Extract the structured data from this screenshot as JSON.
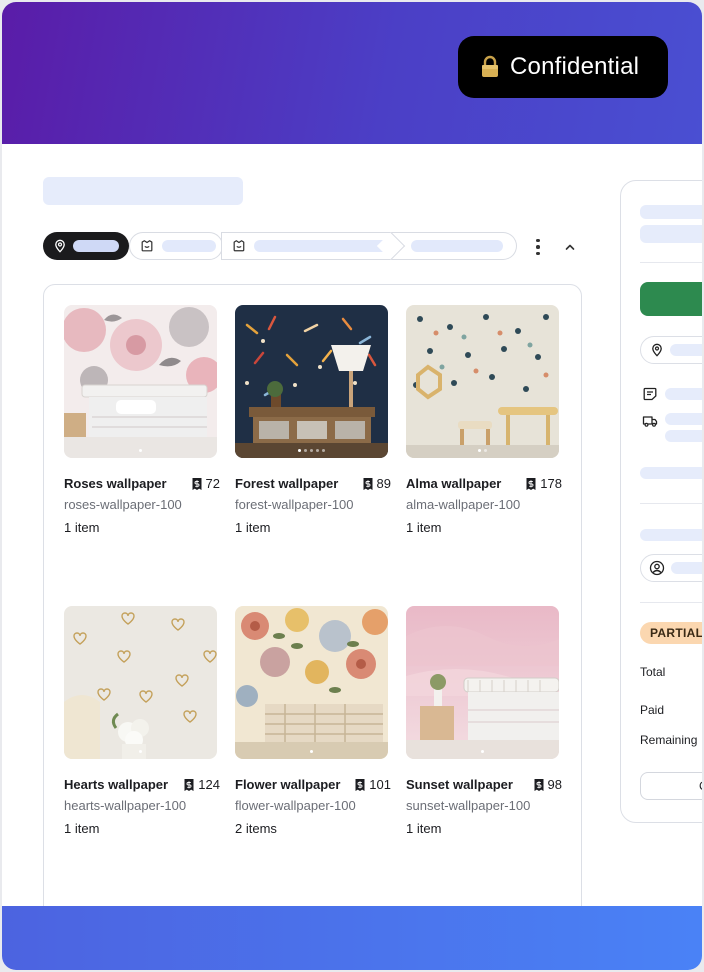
{
  "banner": {
    "confidential_label": "Confidential"
  },
  "products": [
    {
      "name": "Roses wallpaper",
      "count": "72",
      "handle": "roses-wallpaper-100",
      "items": "1 item"
    },
    {
      "name": "Forest wallpaper",
      "count": "89",
      "handle": "forest-wallpaper-100",
      "items": "1 item"
    },
    {
      "name": "Alma wallpaper",
      "count": "178",
      "handle": "alma-wallpaper-100",
      "items": "1 item"
    },
    {
      "name": "Hearts wallpaper",
      "count": "124",
      "handle": "hearts-wallpaper-100",
      "items": "1 item"
    },
    {
      "name": "Flower wallpaper",
      "count": "101",
      "handle": "flower-wallpaper-100",
      "items": "2 items"
    },
    {
      "name": "Sunset wallpaper",
      "count": "98",
      "handle": "sunset-wallpaper-100",
      "items": "1 item"
    }
  ],
  "order_summary": {
    "status_badge": "PARTIALL",
    "total_label": "Total",
    "paid_label": "Paid",
    "remaining_label": "Remaining",
    "button_label": "C"
  },
  "colors": {
    "banner_gradient": [
      "#5a1ca8",
      "#4a4fd2"
    ],
    "footer_gradient": [
      "#4c63e0",
      "#4a82f6"
    ],
    "primary_action": "#2d8a4f",
    "status_badge_bg": "#fbd7b0",
    "skeleton": "#e6ecfb"
  },
  "icons": [
    "lock-icon",
    "location-pin-icon",
    "collection-icon",
    "more-vertical-icon",
    "chevron-up-icon",
    "receipt-icon",
    "note-icon",
    "truck-icon",
    "user-circle-icon"
  ]
}
